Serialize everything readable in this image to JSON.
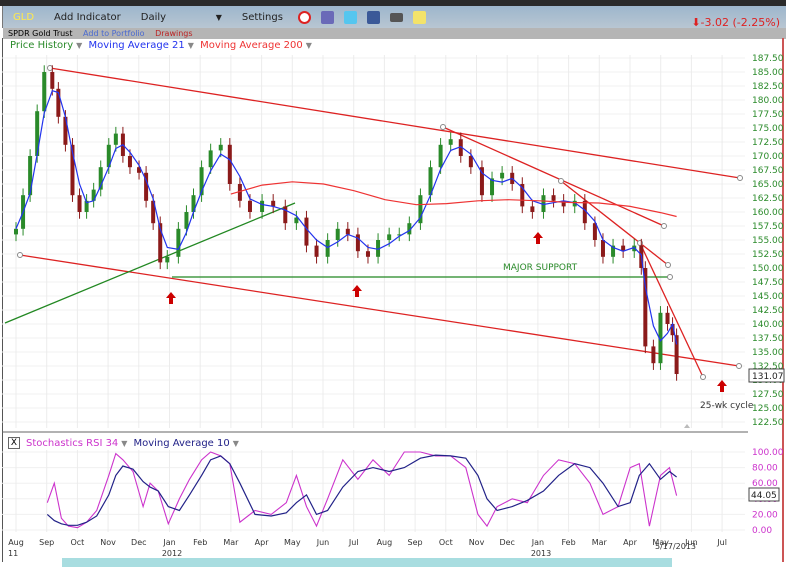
{
  "toolbar": {
    "symbol": "GLD",
    "add_indicator": "Add Indicator",
    "interval": "Daily",
    "settings": "Settings",
    "change": "-3.02 (-2.25%)",
    "icons": [
      "alarm-clock-icon",
      "books-icon",
      "twitter-icon",
      "facebook-icon",
      "camera-icon",
      "note-icon"
    ]
  },
  "subbar": {
    "name": "SPDR Gold Trust",
    "add_portfolio": "Add to Portfolio",
    "drawings": "Drawings"
  },
  "legend": {
    "price": "Price History",
    "ma21": "Moving Average 21",
    "ma200": "Moving Average 200"
  },
  "colors": {
    "price_up": "#2a8a2a",
    "price_down": "#8b1a1a",
    "ma21": "#2233ee",
    "ma200": "#ee3333",
    "stoch": "#cc33cc",
    "stoch_ma": "#222288",
    "axis_price": "#2a8a2a",
    "axis_stoch": "#cc33cc",
    "trendline": "#dd2222",
    "support": "#228822",
    "arrow": "#cc0000"
  },
  "annotations": {
    "support": "MAJOR SUPPORT",
    "cycle": "25-wk cycle",
    "last_price": "131.07",
    "last_stoch": "44.05",
    "date_label": "5/17/2013"
  },
  "stoch_legend": {
    "stoch": "Stochastics RSI 34",
    "ma": "Moving Average 10",
    "close": "X"
  },
  "chart_data": [
    {
      "type": "candlestick",
      "title": "Price History",
      "y_ticks": [
        "187.50",
        "185.00",
        "182.50",
        "180.00",
        "177.50",
        "175.00",
        "172.50",
        "170.00",
        "167.50",
        "165.00",
        "162.50",
        "160.00",
        "157.50",
        "155.00",
        "152.50",
        "150.00",
        "147.50",
        "145.00",
        "142.50",
        "140.00",
        "137.50",
        "135.00",
        "132.50",
        "130.00",
        "127.50",
        "125.00",
        "122.50"
      ],
      "ylim": [
        122.5,
        187.5
      ],
      "x_ticks": [
        "Aug",
        "Sep",
        "Oct",
        "Nov",
        "Dec",
        "Jan",
        "Feb",
        "Mar",
        "Apr",
        "May",
        "Jun",
        "Jul",
        "Aug",
        "Sep",
        "Oct",
        "Nov",
        "Dec",
        "Jan",
        "Feb",
        "Mar",
        "Apr",
        "May",
        "Jun",
        "Jul"
      ],
      "x_years": [
        "11",
        "2012",
        "2013"
      ],
      "dates": [
        "2011-08-01",
        "2011-08-08",
        "2011-08-15",
        "2011-08-22",
        "2011-08-29",
        "2011-09-06",
        "2011-09-12",
        "2011-09-19",
        "2011-09-26",
        "2011-10-03",
        "2011-10-10",
        "2011-10-17",
        "2011-10-24",
        "2011-11-01",
        "2011-11-08",
        "2011-11-15",
        "2011-11-22",
        "2011-12-01",
        "2011-12-08",
        "2011-12-15",
        "2011-12-22",
        "2011-12-29",
        "2012-01-09",
        "2012-01-17",
        "2012-01-24",
        "2012-02-01",
        "2012-02-10",
        "2012-02-20",
        "2012-02-29",
        "2012-03-10",
        "2012-03-20",
        "2012-04-01",
        "2012-04-12",
        "2012-04-24",
        "2012-05-05",
        "2012-05-15",
        "2012-05-25",
        "2012-06-05",
        "2012-06-15",
        "2012-06-25",
        "2012-07-05",
        "2012-07-15",
        "2012-07-25",
        "2012-08-05",
        "2012-08-15",
        "2012-08-25",
        "2012-09-05",
        "2012-09-15",
        "2012-09-25",
        "2012-10-05",
        "2012-10-15",
        "2012-10-25",
        "2012-11-05",
        "2012-11-15",
        "2012-11-25",
        "2012-12-05",
        "2012-12-15",
        "2012-12-25",
        "2013-01-05",
        "2013-01-15",
        "2013-01-25",
        "2013-02-05",
        "2013-02-15",
        "2013-02-25",
        "2013-03-05",
        "2013-03-15",
        "2013-03-25",
        "2013-04-05",
        "2013-04-12",
        "2013-04-16",
        "2013-04-24",
        "2013-05-01",
        "2013-05-08",
        "2013-05-13",
        "2013-05-17"
      ],
      "close": [
        157,
        163,
        170,
        178,
        185,
        182,
        177,
        172,
        163,
        160,
        162,
        164,
        168,
        172,
        174,
        170,
        168,
        167,
        162,
        158,
        151,
        152,
        157,
        160,
        163,
        168,
        171,
        172,
        165,
        162,
        160,
        162,
        161,
        158,
        159,
        154,
        152,
        155,
        157,
        156,
        153,
        152,
        155,
        156,
        156,
        158,
        163,
        168,
        172,
        173,
        170,
        168,
        163,
        166,
        167,
        165,
        161,
        160,
        163,
        162,
        161,
        162,
        158,
        155,
        152,
        154,
        153,
        154,
        150,
        136,
        133,
        142,
        140,
        138,
        131.07
      ],
      "ma200_dates": [
        "2012-03-01",
        "2012-04-01",
        "2012-05-01",
        "2012-06-01",
        "2012-07-01",
        "2012-08-01",
        "2012-09-01",
        "2012-10-01",
        "2012-11-01",
        "2012-12-01",
        "2013-01-01",
        "2013-02-01",
        "2013-03-01",
        "2013-04-01",
        "2013-05-01",
        "2013-05-17"
      ],
      "ma200": [
        163.2,
        164.8,
        165.4,
        165.0,
        163.8,
        162.2,
        161.3,
        161.5,
        162.0,
        162.2,
        162.0,
        161.7,
        161.6,
        161.0,
        159.9,
        159.2
      ]
    },
    {
      "type": "line",
      "title": "Stochastics RSI 34",
      "y_ticks": [
        "100.00",
        "80.00",
        "60.00",
        "40.00",
        "20.00",
        "0.00"
      ],
      "ylim": [
        0,
        100
      ],
      "dates": [
        "2011-09-01",
        "2011-09-08",
        "2011-09-15",
        "2011-09-22",
        "2011-10-01",
        "2011-10-10",
        "2011-10-20",
        "2011-11-01",
        "2011-11-08",
        "2011-11-15",
        "2011-11-25",
        "2011-12-05",
        "2011-12-12",
        "2011-12-20",
        "2011-12-30",
        "2012-01-10",
        "2012-01-20",
        "2012-02-01",
        "2012-02-10",
        "2012-02-20",
        "2012-02-29",
        "2012-03-10",
        "2012-03-25",
        "2012-04-10",
        "2012-04-25",
        "2012-05-05",
        "2012-05-15",
        "2012-05-25",
        "2012-06-05",
        "2012-06-20",
        "2012-07-05",
        "2012-07-20",
        "2012-08-05",
        "2012-08-20",
        "2012-09-05",
        "2012-09-20",
        "2012-10-05",
        "2012-10-20",
        "2012-11-01",
        "2012-11-10",
        "2012-11-20",
        "2012-12-05",
        "2012-12-20",
        "2013-01-05",
        "2013-01-20",
        "2013-02-05",
        "2013-02-20",
        "2013-03-05",
        "2013-03-20",
        "2013-04-01",
        "2013-04-10",
        "2013-04-20",
        "2013-05-01",
        "2013-05-10",
        "2013-05-17"
      ],
      "stoch": [
        35,
        60,
        15,
        5,
        3,
        10,
        25,
        70,
        98,
        90,
        75,
        30,
        60,
        50,
        8,
        40,
        65,
        90,
        100,
        95,
        85,
        10,
        25,
        20,
        35,
        70,
        30,
        5,
        40,
        90,
        65,
        90,
        70,
        100,
        100,
        95,
        95,
        80,
        20,
        5,
        30,
        40,
        35,
        70,
        90,
        85,
        60,
        20,
        30,
        80,
        85,
        5,
        70,
        80,
        44.05
      ],
      "ma10": [
        20,
        12,
        8,
        6,
        6,
        10,
        18,
        45,
        70,
        82,
        78,
        62,
        55,
        50,
        30,
        25,
        45,
        70,
        90,
        95,
        85,
        60,
        20,
        18,
        22,
        35,
        45,
        20,
        25,
        55,
        75,
        80,
        75,
        80,
        92,
        96,
        95,
        92,
        70,
        40,
        25,
        30,
        38,
        50,
        70,
        85,
        80,
        60,
        30,
        35,
        70,
        85,
        65,
        75,
        68
      ]
    }
  ]
}
